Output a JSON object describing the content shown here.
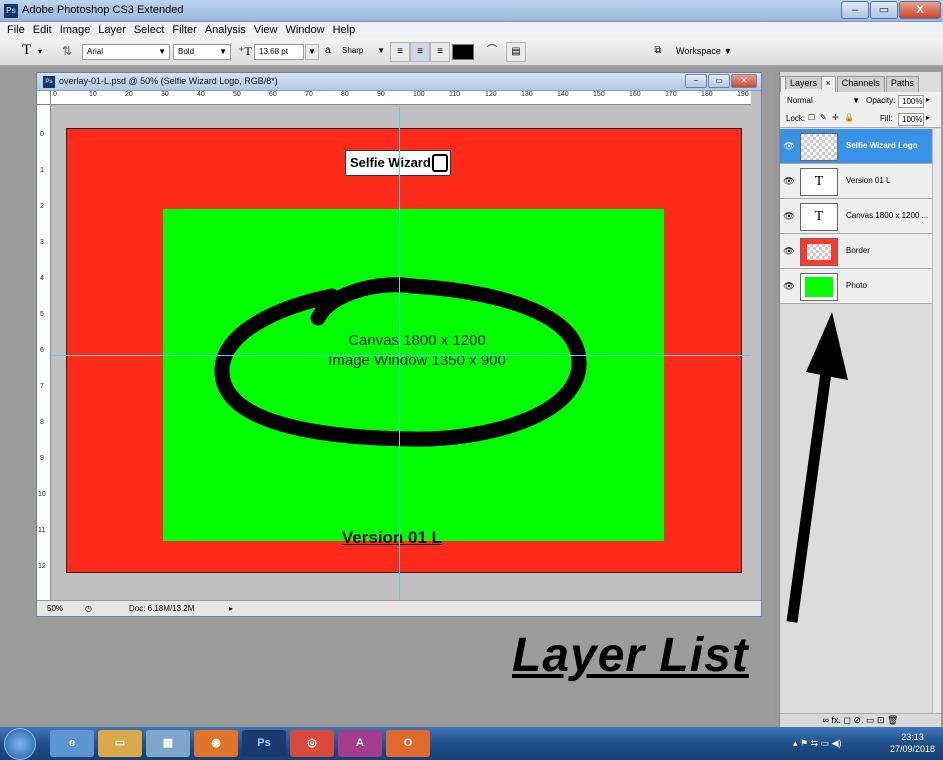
{
  "app": {
    "title": "Adobe Photoshop CS3 Extended",
    "icon_label": "Ps"
  },
  "menu": [
    "File",
    "Edit",
    "Image",
    "Layer",
    "Select",
    "Filter",
    "Analysis",
    "View",
    "Window",
    "Help"
  ],
  "options_bar": {
    "tool_glyph": "T",
    "font_family": "Arial",
    "font_style": "Bold",
    "font_size": "13.68 pt",
    "aa_label": "a",
    "aa_mode": "Sharp",
    "workspace_label": "Workspace ▼"
  },
  "document": {
    "title": "overlay-01-L.psd @ 50% (Selfie Wizard Logo, RGB/8*)",
    "ruler_h": [
      "0",
      "10",
      "20",
      "30",
      "40",
      "50",
      "60",
      "70",
      "80",
      "90",
      "100",
      "110",
      "120",
      "130",
      "140",
      "150",
      "160",
      "170",
      "180",
      "190"
    ],
    "ruler_v": [
      "0",
      "1",
      "2",
      "3",
      "4",
      "5",
      "6",
      "7",
      "8",
      "9",
      "10",
      "11",
      "12"
    ],
    "canvas": {
      "logo_text": "Selfie Wizard",
      "line1": "Canvas 1800 x 1200",
      "line2": "Image Window 1350 x 900",
      "version": "Version 01 L"
    },
    "status": {
      "zoom": "50%",
      "doc_info": "Doc: 6.18M/13.2M"
    }
  },
  "layers_panel": {
    "tabs": [
      "Layers",
      "Channels",
      "Paths"
    ],
    "blend_mode": "Normal",
    "opacity_label": "Opacity:",
    "opacity_value": "100%",
    "lock_label": "Lock:",
    "fill_label": "Fill:",
    "fill_value": "100%",
    "layers": [
      {
        "name": "Selfie Wizard Logo",
        "thumb": "checker",
        "selected": true
      },
      {
        "name": "Version 01 L",
        "thumb": "text",
        "selected": false
      },
      {
        "name": "Canvas 1800 x 1200 ...",
        "thumb": "text",
        "selected": false
      },
      {
        "name": "Border",
        "thumb": "red",
        "selected": false
      },
      {
        "name": "Photo",
        "thumb": "green",
        "selected": false
      }
    ],
    "bottom_icons": "∞  fx.  ◻  ⊘.  ▭  ⊡  🗑"
  },
  "annotation": {
    "text": "Layer List"
  },
  "taskbar": {
    "apps": [
      "ie",
      "folder",
      "calc",
      "firefox",
      "Ps",
      "chrome",
      "A",
      "Office"
    ],
    "time": "23:13",
    "date": "27/09/2018"
  },
  "colors": {
    "border_red": "#ff2a1a",
    "photo_green": "#00ff00",
    "guide_cyan": "#4fd6e6",
    "selected_layer": "#3a91e8"
  }
}
